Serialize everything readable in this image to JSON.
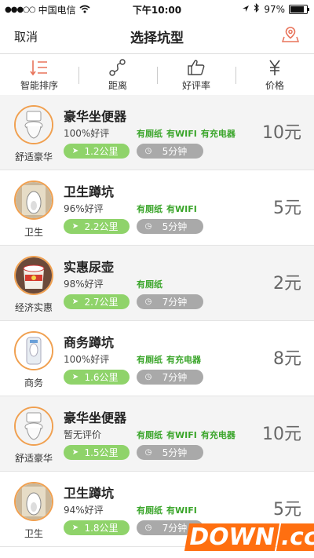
{
  "status_bar": {
    "signal_dots": "●●●○○",
    "carrier": "中国电信",
    "time": "下午10:00",
    "battery": "97%",
    "battery_level": 0.97
  },
  "navbar": {
    "cancel_label": "取消",
    "title": "选择坑型",
    "map_icon": "location-map-icon"
  },
  "sort_bar": {
    "items": [
      {
        "label": "智能排序",
        "icon": "smart-sort-icon"
      },
      {
        "label": "距离",
        "icon": "route-icon"
      },
      {
        "label": "好评率",
        "icon": "thumbs-up-icon"
      },
      {
        "label": "价格",
        "icon": "yen-icon"
      }
    ]
  },
  "accent_colors": {
    "avatar_border": "#f0a050",
    "amenity_text": "#3aa52a",
    "distance_pill": "#8fd36a",
    "time_pill": "#a9a9a9"
  },
  "toilets": [
    {
      "name": "豪华坐便器",
      "category": "舒适豪华",
      "rating": "100%好评",
      "amenities": [
        "有厕纸",
        "有WIFI",
        "有充电器"
      ],
      "distance": "1.2公里",
      "time": "5分钟",
      "price": "10元",
      "icon": "western-toilet-icon"
    },
    {
      "name": "卫生蹲坑",
      "category": "卫生",
      "rating": "96%好评",
      "amenities": [
        "有厕纸",
        "有WIFI"
      ],
      "distance": "2.2公里",
      "time": "5分钟",
      "price": "5元",
      "icon": "squat-toilet-icon"
    },
    {
      "name": "实惠尿壶",
      "category": "经济实惠",
      "rating": "98%好评",
      "amenities": [
        "有厕纸"
      ],
      "distance": "2.7公里",
      "time": "7分钟",
      "price": "2元",
      "icon": "chamber-pot-icon"
    },
    {
      "name": "商务蹲坑",
      "category": "商务",
      "rating": "100%好评",
      "amenities": [
        "有厕纸",
        "有充电器"
      ],
      "distance": "1.6公里",
      "time": "7分钟",
      "price": "8元",
      "icon": "business-toilet-icon"
    },
    {
      "name": "豪华坐便器",
      "category": "舒适豪华",
      "rating": "暂无评价",
      "amenities": [
        "有厕纸",
        "有WIFI",
        "有充电器"
      ],
      "distance": "1.5公里",
      "time": "5分钟",
      "price": "10元",
      "icon": "western-toilet-icon"
    },
    {
      "name": "卫生蹲坑",
      "category": "卫生",
      "rating": "94%好评",
      "amenities": [
        "有厕纸",
        "有WIFI"
      ],
      "distance": "1.8公里",
      "time": "7分钟",
      "price": "5元",
      "icon": "squat-toilet-icon"
    }
  ],
  "watermark": {
    "part1": "DOWN",
    "part2": ".cc"
  }
}
